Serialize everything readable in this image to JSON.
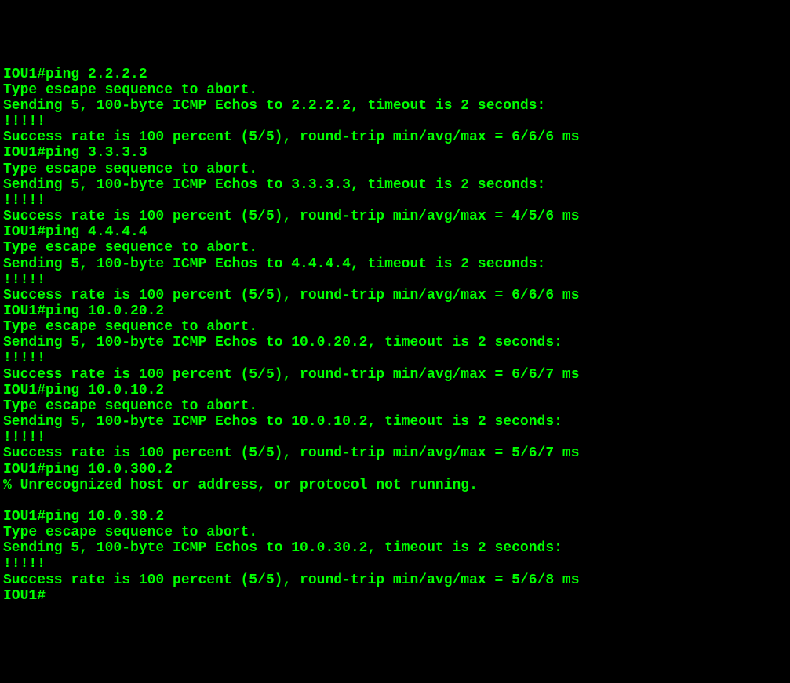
{
  "terminal": {
    "lines": [
      "IOU1#ping 2.2.2.2",
      "Type escape sequence to abort.",
      "Sending 5, 100-byte ICMP Echos to 2.2.2.2, timeout is 2 seconds:",
      "!!!!!",
      "Success rate is 100 percent (5/5), round-trip min/avg/max = 6/6/6 ms",
      "IOU1#ping 3.3.3.3",
      "Type escape sequence to abort.",
      "Sending 5, 100-byte ICMP Echos to 3.3.3.3, timeout is 2 seconds:",
      "!!!!!",
      "Success rate is 100 percent (5/5), round-trip min/avg/max = 4/5/6 ms",
      "IOU1#ping 4.4.4.4",
      "Type escape sequence to abort.",
      "Sending 5, 100-byte ICMP Echos to 4.4.4.4, timeout is 2 seconds:",
      "!!!!!",
      "Success rate is 100 percent (5/5), round-trip min/avg/max = 6/6/6 ms",
      "IOU1#ping 10.0.20.2",
      "Type escape sequence to abort.",
      "Sending 5, 100-byte ICMP Echos to 10.0.20.2, timeout is 2 seconds:",
      "!!!!!",
      "Success rate is 100 percent (5/5), round-trip min/avg/max = 6/6/7 ms",
      "IOU1#ping 10.0.10.2",
      "Type escape sequence to abort.",
      "Sending 5, 100-byte ICMP Echos to 10.0.10.2, timeout is 2 seconds:",
      "!!!!!",
      "Success rate is 100 percent (5/5), round-trip min/avg/max = 5/6/7 ms",
      "IOU1#ping 10.0.300.2",
      "% Unrecognized host or address, or protocol not running.",
      "",
      "IOU1#ping 10.0.30.2",
      "Type escape sequence to abort.",
      "Sending 5, 100-byte ICMP Echos to 10.0.30.2, timeout is 2 seconds:",
      "!!!!!",
      "Success rate is 100 percent (5/5), round-trip min/avg/max = 5/6/8 ms",
      "IOU1#"
    ]
  }
}
